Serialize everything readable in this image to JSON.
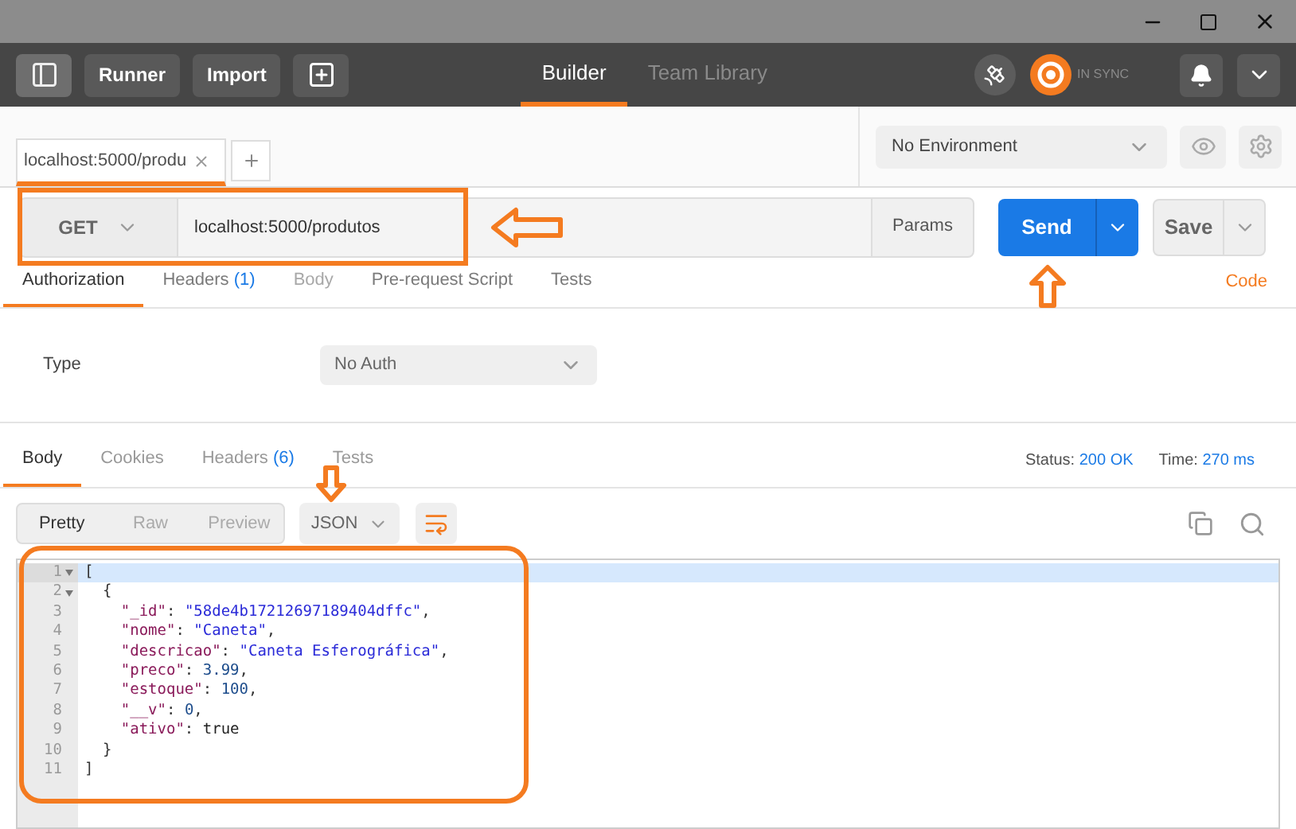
{
  "header": {
    "buttons": [
      "Runner",
      "Import"
    ],
    "tabs": [
      {
        "label": "Builder",
        "selected": true
      },
      {
        "label": "Team Library",
        "selected": false
      }
    ],
    "sync_status": "IN SYNC"
  },
  "request_tabs": [
    {
      "label": "localhost:5000/produ",
      "selected": true
    }
  ],
  "environment": {
    "value": "No Environment"
  },
  "request": {
    "method": "GET",
    "url": "localhost:5000/produtos",
    "params": "Params",
    "send": "Send",
    "save": "Save"
  },
  "request_tabs_bar": {
    "tabs": [
      {
        "label": "Authorization",
        "selected": true,
        "disabled": false
      },
      {
        "label": "Headers",
        "count": "(1)",
        "selected": false,
        "disabled": false
      },
      {
        "label": "Body",
        "selected": false,
        "disabled": true
      },
      {
        "label": "Pre-request Script",
        "selected": false,
        "disabled": false
      },
      {
        "label": "Tests",
        "selected": false,
        "disabled": false
      }
    ],
    "code_link": "Code"
  },
  "auth": {
    "label": "Type",
    "value": "No Auth"
  },
  "response": {
    "tabs": [
      {
        "label": "Body",
        "selected": true
      },
      {
        "label": "Cookies",
        "selected": false
      },
      {
        "label": "Headers",
        "count": "(6)",
        "selected": false
      },
      {
        "label": "Tests",
        "selected": false
      }
    ],
    "status_label": "Status:",
    "status": "200 OK",
    "time_label": "Time:",
    "time": "270 ms",
    "views": [
      {
        "label": "Pretty",
        "selected": true
      },
      {
        "label": "Raw",
        "selected": false
      },
      {
        "label": "Preview",
        "selected": false
      }
    ],
    "format": "JSON"
  },
  "code_lines": [
    {
      "number": "1",
      "foldable": true,
      "highlighted": true,
      "tokens": [
        {
          "kind": "punct",
          "text": "["
        }
      ]
    },
    {
      "number": "2",
      "foldable": true,
      "highlighted": false,
      "tokens": [
        {
          "kind": "punct",
          "text": "  {"
        }
      ]
    },
    {
      "number": "3",
      "foldable": false,
      "highlighted": false,
      "tokens": [
        {
          "kind": "key",
          "text": "    \"_id\""
        },
        {
          "kind": "punct",
          "text": ": "
        },
        {
          "kind": "string",
          "text": "\"58de4b17212697189404dffc\""
        },
        {
          "kind": "punct",
          "text": ","
        }
      ]
    },
    {
      "number": "4",
      "foldable": false,
      "highlighted": false,
      "tokens": [
        {
          "kind": "key",
          "text": "    \"nome\""
        },
        {
          "kind": "punct",
          "text": ": "
        },
        {
          "kind": "string",
          "text": "\"Caneta\""
        },
        {
          "kind": "punct",
          "text": ","
        }
      ]
    },
    {
      "number": "5",
      "foldable": false,
      "highlighted": false,
      "tokens": [
        {
          "kind": "key",
          "text": "    \"descricao\""
        },
        {
          "kind": "punct",
          "text": ": "
        },
        {
          "kind": "string",
          "text": "\"Caneta Esferográfica\""
        },
        {
          "kind": "punct",
          "text": ","
        }
      ]
    },
    {
      "number": "6",
      "foldable": false,
      "highlighted": false,
      "tokens": [
        {
          "kind": "key",
          "text": "    \"preco\""
        },
        {
          "kind": "punct",
          "text": ": "
        },
        {
          "kind": "number",
          "text": "3.99"
        },
        {
          "kind": "punct",
          "text": ","
        }
      ]
    },
    {
      "number": "7",
      "foldable": false,
      "highlighted": false,
      "tokens": [
        {
          "kind": "key",
          "text": "    \"estoque\""
        },
        {
          "kind": "punct",
          "text": ": "
        },
        {
          "kind": "number",
          "text": "100"
        },
        {
          "kind": "punct",
          "text": ","
        }
      ]
    },
    {
      "number": "8",
      "foldable": false,
      "highlighted": false,
      "tokens": [
        {
          "kind": "key",
          "text": "    \"__v\""
        },
        {
          "kind": "punct",
          "text": ": "
        },
        {
          "kind": "number",
          "text": "0"
        },
        {
          "kind": "punct",
          "text": ","
        }
      ]
    },
    {
      "number": "9",
      "foldable": false,
      "highlighted": false,
      "tokens": [
        {
          "kind": "key",
          "text": "    \"ativo\""
        },
        {
          "kind": "punct",
          "text": ": "
        },
        {
          "kind": "bool",
          "text": "true"
        }
      ]
    },
    {
      "number": "10",
      "foldable": false,
      "highlighted": false,
      "tokens": [
        {
          "kind": "punct",
          "text": "  }"
        }
      ]
    },
    {
      "number": "11",
      "foldable": false,
      "highlighted": false,
      "tokens": [
        {
          "kind": "punct",
          "text": "]"
        }
      ]
    }
  ]
}
